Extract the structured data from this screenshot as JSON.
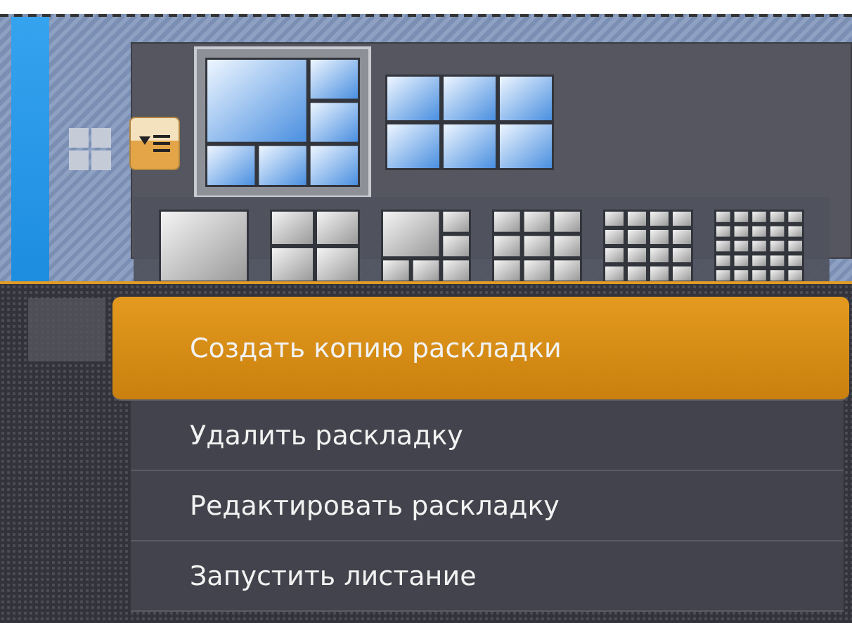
{
  "layouts": [
    {
      "kind": "one-plus-five",
      "selected": true
    },
    {
      "kind": "grid-3x2",
      "selected": false
    }
  ],
  "grid_options": [
    {
      "kind": "single"
    },
    {
      "kind": "quad"
    },
    {
      "kind": "one-plus-five"
    },
    {
      "kind": "grid-3"
    },
    {
      "kind": "grid-4"
    },
    {
      "kind": "grid-5"
    }
  ],
  "menu": [
    {
      "label": "Создать копию раскладки",
      "selected": true
    },
    {
      "label": "Удалить раскладку",
      "selected": false
    },
    {
      "label": "Редактировать раскладку",
      "selected": false
    },
    {
      "label": "Запустить листание",
      "selected": false
    }
  ]
}
